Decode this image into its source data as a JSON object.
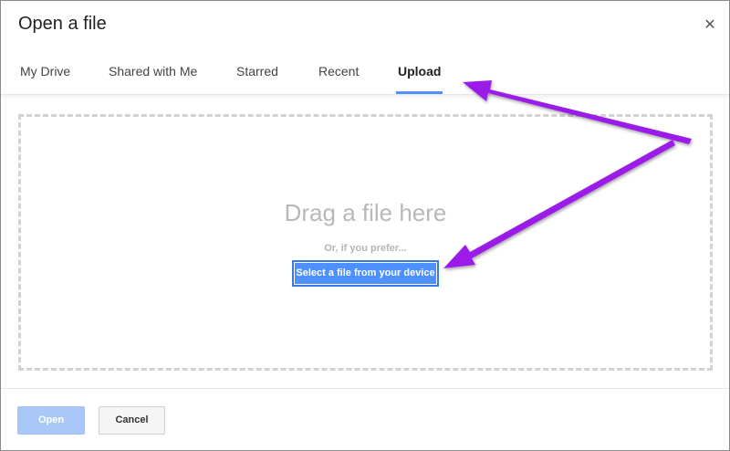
{
  "dialog": {
    "title": "Open a file",
    "close_icon": "close-icon",
    "close_glyph": "✕"
  },
  "tabs": [
    {
      "label": "My Drive",
      "active": false
    },
    {
      "label": "Shared with Me",
      "active": false
    },
    {
      "label": "Starred",
      "active": false
    },
    {
      "label": "Recent",
      "active": false
    },
    {
      "label": "Upload",
      "active": true
    }
  ],
  "upload": {
    "drag_text": "Drag a file here",
    "prefer_text": "Or, if you prefer...",
    "select_button_label": "Select a file from your device"
  },
  "footer": {
    "open_label": "Open",
    "cancel_label": "Cancel"
  },
  "colors": {
    "accent": "#4d90fe",
    "open_disabled": "#a9c8f7",
    "annotation_arrow": "#9b1fe8"
  }
}
